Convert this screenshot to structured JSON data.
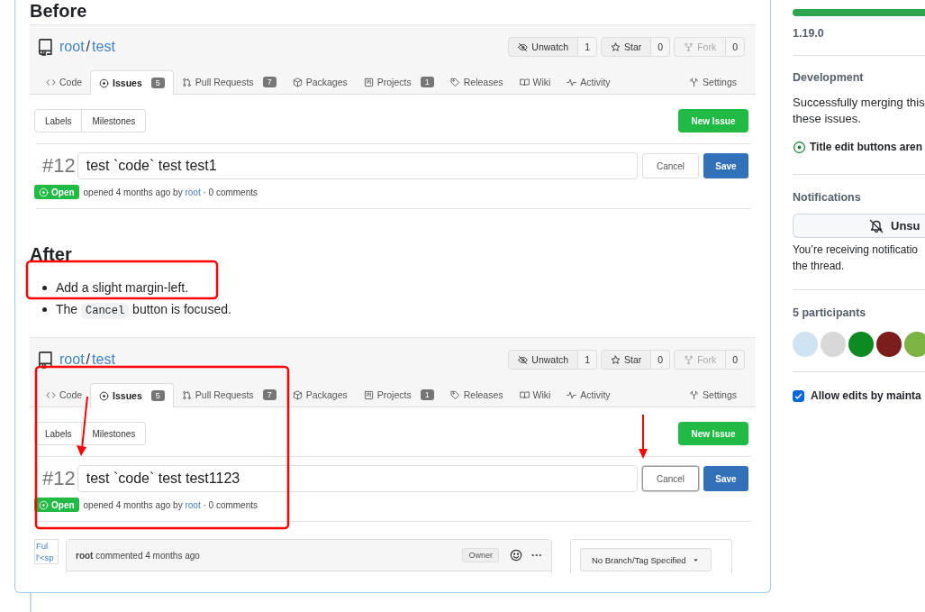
{
  "comment": {
    "sections": [
      {
        "heading": "Before",
        "shot": {
          "repo_owner": "root",
          "repo_separator": "/",
          "repo_name": "test",
          "actions": [
            {
              "label": "Unwatch",
              "count": "1",
              "disabled": false
            },
            {
              "label": "Star",
              "count": "0",
              "disabled": false
            },
            {
              "label": "Fork",
              "count": "0",
              "disabled": true
            }
          ],
          "tabs": [
            {
              "label": "Code",
              "selected": false
            },
            {
              "label": "Issues",
              "badge": "5",
              "selected": true
            },
            {
              "label": "Pull Requests",
              "badge": "7",
              "selected": false
            },
            {
              "label": "Packages",
              "selected": false
            },
            {
              "label": "Projects",
              "badge": "1",
              "selected": false
            },
            {
              "label": "Releases",
              "selected": false
            },
            {
              "label": "Wiki",
              "selected": false
            },
            {
              "label": "Activity",
              "selected": false
            }
          ],
          "settings_tab": "Settings",
          "filters": [
            "Labels",
            "Milestones"
          ],
          "new_issue_button": "New Issue",
          "issue_number": "#12",
          "title_value": "test `code` test test1",
          "cancel": {
            "label": "Cancel",
            "focused": false
          },
          "save_button": "Save",
          "state": "Open",
          "meta": {
            "prefix": "opened 4 months ago by ",
            "author": "root",
            "suffix": " · 0 comments"
          }
        }
      },
      {
        "heading": "After",
        "notes": [
          {
            "parts": [
              {
                "text": "Add a slight margin-left.",
                "code": false
              }
            ]
          },
          {
            "parts": [
              {
                "text": "The ",
                "code": false
              },
              {
                "text": "Cancel",
                "code": true
              },
              {
                "text": " button is focused.",
                "code": false
              }
            ]
          }
        ],
        "shot": {
          "repo_owner": "root",
          "repo_separator": "/",
          "repo_name": "test",
          "actions": [
            {
              "label": "Unwatch",
              "count": "1",
              "disabled": false
            },
            {
              "label": "Star",
              "count": "0",
              "disabled": false
            },
            {
              "label": "Fork",
              "count": "0",
              "disabled": true
            }
          ],
          "tabs": [
            {
              "label": "Code",
              "selected": false
            },
            {
              "label": "Issues",
              "badge": "5",
              "selected": true
            },
            {
              "label": "Pull Requests",
              "badge": "7",
              "selected": false
            },
            {
              "label": "Packages",
              "selected": false
            },
            {
              "label": "Projects",
              "badge": "1",
              "selected": false
            },
            {
              "label": "Releases",
              "selected": false
            },
            {
              "label": "Wiki",
              "selected": false
            },
            {
              "label": "Activity",
              "selected": false
            }
          ],
          "settings_tab": "Settings",
          "filters": [
            "Labels",
            "Milestones"
          ],
          "new_issue_button": "New Issue",
          "issue_number": "#12",
          "title_value": "test `code` test test1123",
          "cancel": {
            "label": "Cancel",
            "focused": true
          },
          "save_button": "Save",
          "state": "Open",
          "meta": {
            "prefix": "opened 4 months ago by ",
            "author": "root",
            "suffix": " · 0 comments"
          },
          "comment": {
            "avatar_alt": [
              "Ful",
              "l'<sp"
            ],
            "text": "**root** commented 4 months ago",
            "role": "Owner",
            "more": "···",
            "branch_button": "No Branch/Tag Specified"
          }
        }
      }
    ]
  },
  "sidebar": {
    "milestone": {
      "level": 1,
      "version": "1.19.0"
    },
    "development": {
      "heading": "Development",
      "lines": [
        "Successfully merging this",
        "these issues."
      ],
      "linked_issue": "Title edit buttons aren"
    },
    "notifications": {
      "heading": "Notifications",
      "button": "Unsu",
      "lines": [
        "You’re receiving notificatio",
        "the thread."
      ]
    },
    "participants": {
      "heading": "5 participants",
      "avatars": [
        {
          "color": "#cfe3f3"
        },
        {
          "color": "#d8d8d8"
        },
        {
          "color": "#0f8a23"
        },
        {
          "color": "#7b1d1d"
        },
        {
          "color": "#7cb342"
        }
      ]
    },
    "maintainer_edits": {
      "label": "Allow edits by mainta",
      "checked": true
    }
  }
}
